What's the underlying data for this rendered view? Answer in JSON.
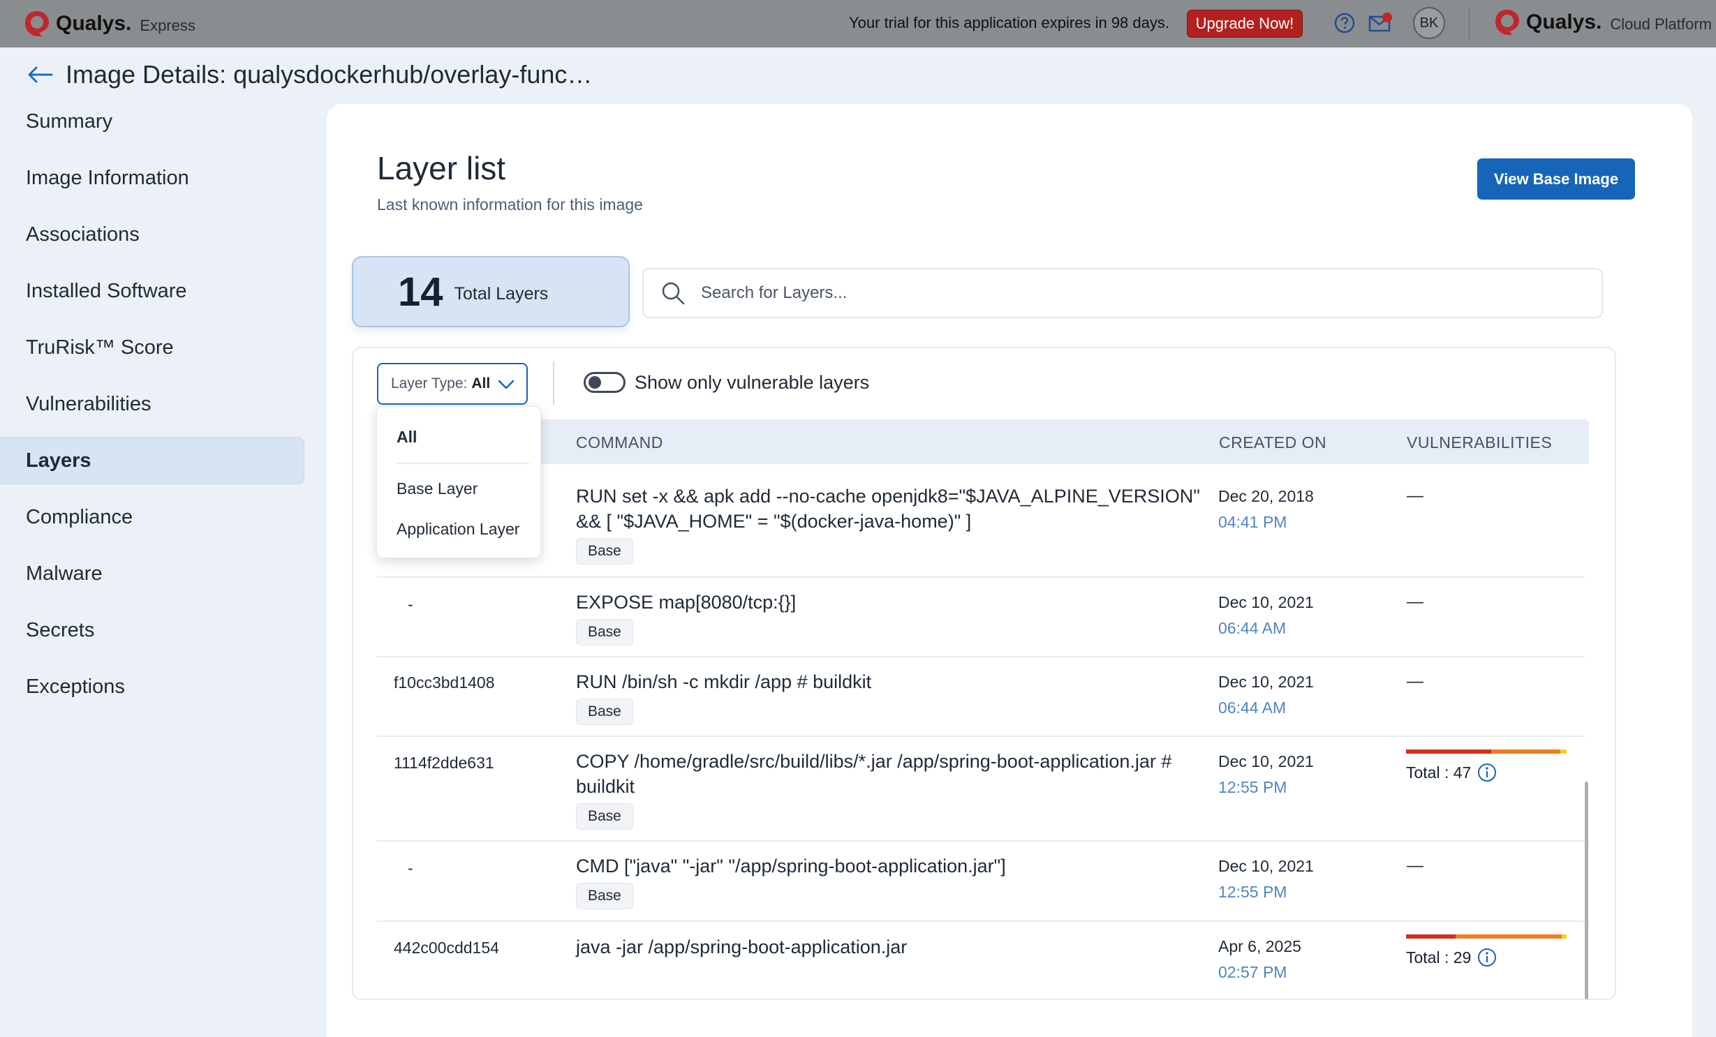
{
  "topbar": {
    "brand": "Qualys.",
    "brand_sub": "Express",
    "trial_text": "Your trial for this application expires in 98 days.",
    "upgrade_label": "Upgrade Now!",
    "avatar_initials": "BK",
    "brand2": "Qualys.",
    "brand2_sub": "Cloud Platform",
    "help_icon": "help-circle-icon",
    "mail_icon": "notification-mail-icon"
  },
  "header": {
    "title": "Image Details: qualysdockerhub/overlay-func…"
  },
  "sidebar": {
    "items": [
      {
        "label": "Summary"
      },
      {
        "label": "Image Information"
      },
      {
        "label": "Associations"
      },
      {
        "label": "Installed Software"
      },
      {
        "label": "TruRisk™ Score"
      },
      {
        "label": "Vulnerabilities"
      },
      {
        "label": "Layers",
        "active": true
      },
      {
        "label": "Compliance"
      },
      {
        "label": "Malware"
      },
      {
        "label": "Secrets"
      },
      {
        "label": "Exceptions"
      }
    ]
  },
  "main": {
    "title": "Layer list",
    "subtitle": "Last known information for this image",
    "view_base_label": "View Base Image",
    "total_count": "14",
    "total_label": "Total Layers",
    "search_placeholder": "Search for Layers...",
    "filter_prefix": "Layer Type:",
    "filter_value": "All",
    "toggle_label": "Show only vulnerable layers",
    "dropdown": [
      "All",
      "Base Layer",
      "Application Layer"
    ],
    "columns": {
      "command": "COMMAND",
      "created": "CREATED ON",
      "vulns": "VULNERABILITIES"
    },
    "rows": [
      {
        "id": "",
        "command": "RUN set -x && apk add --no-cache openjdk8=\"$JAVA_ALPINE_VERSION\" && [ \"$JAVA_HOME\" = \"$(docker-java-home)\" ]",
        "tag": "Base",
        "date": "Dec 20, 2018",
        "time": "04:41 PM",
        "vulns": "—"
      },
      {
        "id": "-",
        "command": "EXPOSE map[8080/tcp:{}]",
        "tag": "Base",
        "date": "Dec 10, 2021",
        "time": "06:44 AM",
        "vulns": "—"
      },
      {
        "id": "f10cc3bd1408",
        "command": "RUN /bin/sh -c mkdir /app # buildkit",
        "tag": "Base",
        "date": "Dec 10, 2021",
        "time": "06:44 AM",
        "vulns": "—"
      },
      {
        "id": "1114f2dde631",
        "command": "COPY /home/gradle/src/build/libs/*.jar /app/spring-boot-application.jar # buildkit",
        "tag": "Base",
        "date": "Dec 10, 2021",
        "time": "12:55 PM",
        "vulns": "Total : 47",
        "vuln_total": 47,
        "vuln_split": [
          0.53,
          0.43,
          0.04
        ]
      },
      {
        "id": "-",
        "command": "CMD [\"java\" \"-jar\" \"/app/spring-boot-application.jar\"]",
        "tag": "Base",
        "date": "Dec 10, 2021",
        "time": "12:55 PM",
        "vulns": "—"
      },
      {
        "id": "442c00cdd154",
        "command": "java -jar /app/spring-boot-application.jar",
        "tag": "",
        "date": "Apr 6, 2025",
        "time": "02:57 PM",
        "vulns": "Total : 29",
        "vuln_total": 29,
        "vuln_split": [
          0.31,
          0.66,
          0.03
        ]
      }
    ]
  },
  "colors": {
    "brand_red": "#c0272d",
    "primary_blue": "#1665b9",
    "severity": [
      "#d32f1e",
      "#ef7d22",
      "#f6d21a"
    ]
  }
}
